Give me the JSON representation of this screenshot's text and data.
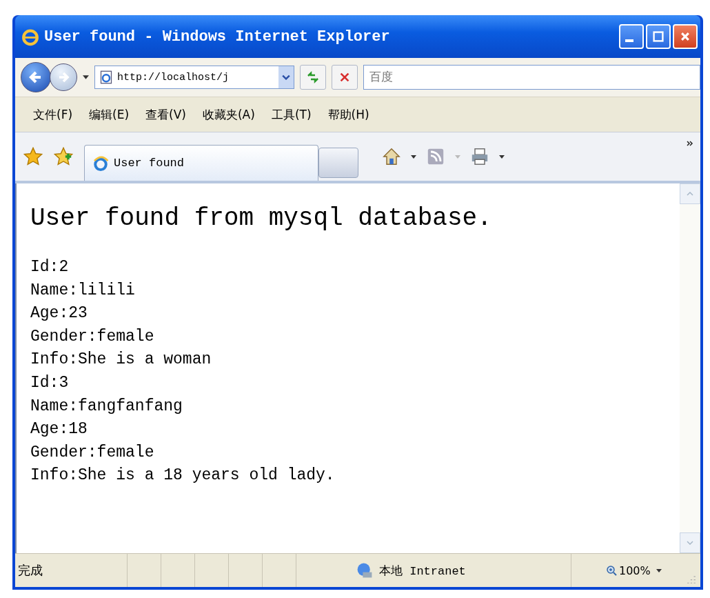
{
  "window": {
    "title": "User found - Windows Internet Explorer"
  },
  "address_bar": {
    "value": "http://localhost/j"
  },
  "search": {
    "placeholder": "百度"
  },
  "menu": [
    "文件(F)",
    "编辑(E)",
    "查看(V)",
    "收藏夹(A)",
    "工具(T)",
    "帮助(H)"
  ],
  "tabs": [
    {
      "label": "User found",
      "selected": true
    }
  ],
  "page": {
    "heading": "User found from mysql database.",
    "lines": [
      "Id:2",
      "Name:lilili",
      "Age:23",
      "Gender:female",
      "Info:She is a woman",
      "Id:3",
      "Name:fangfanfang",
      "Age:18",
      "Gender:female",
      "Info:She is a 18 years old lady."
    ]
  },
  "status_bar": {
    "status": "完成",
    "zone": "本地 Intranet",
    "zoom": "100%"
  }
}
